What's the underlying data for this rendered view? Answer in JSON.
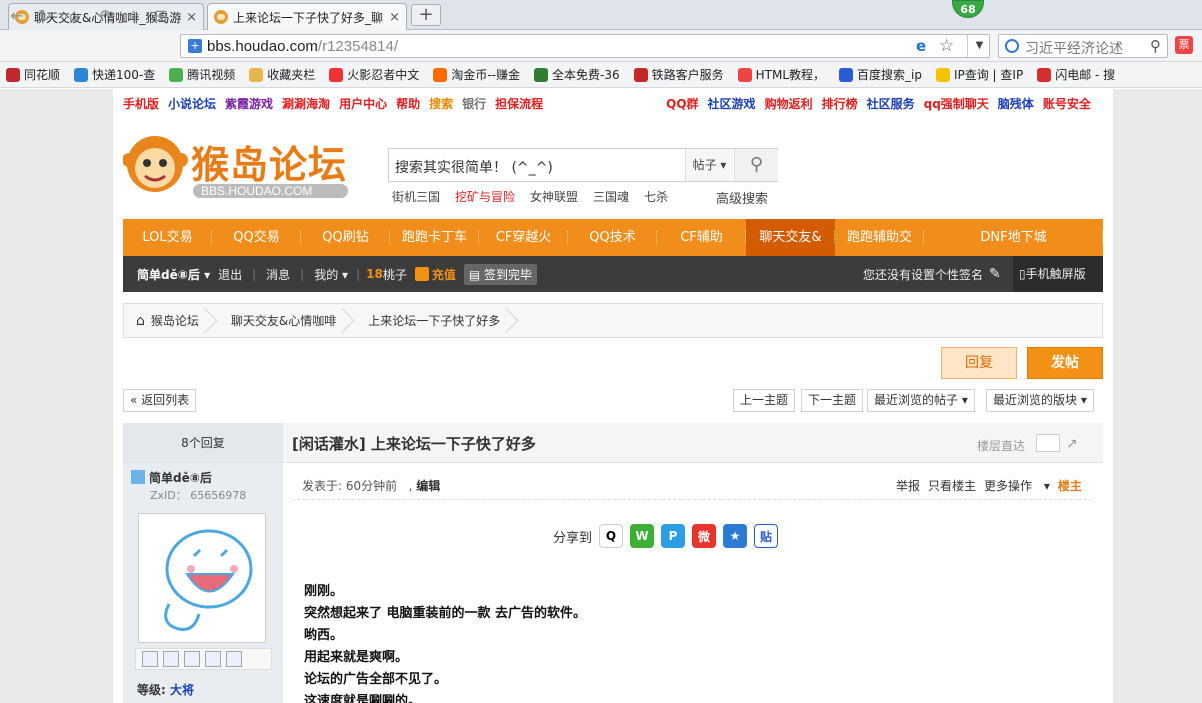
{
  "browser": {
    "tabs": [
      {
        "label": "聊天交友&心情咖啡_猴岛游",
        "close": "×"
      },
      {
        "label": "上来论坛一下子快了好多_聊",
        "close": "×"
      }
    ],
    "new_tab": "+",
    "badge": "68",
    "address": {
      "domain": "bbs.houdao.com",
      "path": "/r12354814/"
    },
    "search_placeholder": "习近平经济论述",
    "bookmarks": [
      {
        "label": "同花顺",
        "color": "#c0282d"
      },
      {
        "label": "快递100-查",
        "color": "#2f86d6"
      },
      {
        "label": "腾讯视频",
        "color": "#4caf50"
      },
      {
        "label": "收藏夹栏",
        "color": "#e8b64c"
      },
      {
        "label": "火影忍者中文",
        "color": "#e33"
      },
      {
        "label": "淘金币--赚金",
        "color": "#ff6a00"
      },
      {
        "label": "全本免费-36",
        "color": "#2e7d32"
      },
      {
        "label": "铁路客户服务",
        "color": "#c62828"
      },
      {
        "label": "HTML教程，",
        "color": "#e44"
      },
      {
        "label": "百度搜索_ip",
        "color": "#2a5bd7"
      },
      {
        "label": "IP查询 | 查IP",
        "color": "#f2c400"
      },
      {
        "label": "闪电邮 - 搜",
        "color": "#d32f2f"
      }
    ]
  },
  "topnav": [
    {
      "label": "手机版",
      "color": "#e02020"
    },
    {
      "label": "小说论坛",
      "color": "#1a3fb5"
    },
    {
      "label": "紫霞游戏",
      "color": "#7a1fa2"
    },
    {
      "label": "涮涮海淘",
      "color": "#e02020"
    },
    {
      "label": "用户中心",
      "color": "#e02020"
    },
    {
      "label": "帮助",
      "color": "#e02020"
    },
    {
      "label": "搜索",
      "color": "#e38b00"
    },
    {
      "label": "银行",
      "color": "#777"
    },
    {
      "label": "担保流程",
      "color": "#e02020"
    },
    {
      "label": "QQ群",
      "color": "#e02020"
    },
    {
      "label": "社区游戏",
      "color": "#1a3fb5"
    },
    {
      "label": "购物返利",
      "color": "#e02020"
    },
    {
      "label": "排行榜",
      "color": "#e02020"
    },
    {
      "label": "社区服务",
      "color": "#1a3fb5"
    },
    {
      "label": "qq强制聊天",
      "color": "#e02020"
    },
    {
      "label": "脑残体",
      "color": "#1a3fb5"
    },
    {
      "label": "账号安全",
      "color": "#e02020"
    }
  ],
  "logo": {
    "title": "猴岛论坛",
    "sub": "BBS.HOUDAO.COM"
  },
  "search": {
    "placeholder": "搜索其实很简单！ (^_^)",
    "type": "帖子",
    "advanced": "高级搜索",
    "hot": [
      "街机三国",
      "挖矿与冒险",
      "女神联盟",
      "三国魂",
      "七杀"
    ]
  },
  "menu": [
    "LOL交易",
    "QQ交易",
    "QQ刷钻",
    "跑跑卡丁车",
    "CF穿越火",
    "QQ技术",
    "CF辅助",
    "聊天交友&",
    "跑跑辅助交",
    "DNF地下城"
  ],
  "userbar": {
    "name": "简单dě⑧后",
    "logout": "退出",
    "messages": "消息",
    "mine": "我的",
    "peaches_num": "18",
    "peaches": "桃子",
    "recharge": "充值",
    "signed": "签到完毕",
    "signature": "您还没有设置个性签名",
    "mobile": "手机触屏版"
  },
  "breadcrumb": [
    "猴岛论坛",
    "聊天交友&心情咖啡",
    "上来论坛一下子快了好多"
  ],
  "actions": {
    "reply": "回复",
    "post": "发帖",
    "back": "« 返回列表",
    "prev": "上一主题",
    "next": "下一主题",
    "recent_posts": "最近浏览的帖子",
    "recent_boards": "最近浏览的版块"
  },
  "thread": {
    "replies": "8个回复",
    "title": "[闲话灌水] 上来论坛一下子快了好多",
    "jump": "楼层直达",
    "posted": "发表于: 60分钟前",
    "edit": "编辑",
    "report": "举报",
    "only_op": "只看楼主",
    "more": "更多操作",
    "op": "楼主",
    "share": "分享到",
    "lines": [
      "刚刚。",
      "突然想起来了 电脑重装前的一款 去广告的软件。",
      "哟西。",
      "用起来就是爽啊。",
      "论坛的广告全部不见了。",
      "这速度就是唰唰的。"
    ]
  },
  "author": {
    "name": "简单dě⑧后",
    "zxid": "ZxID：  65656978",
    "level_label": "等级:",
    "level": "大将"
  }
}
